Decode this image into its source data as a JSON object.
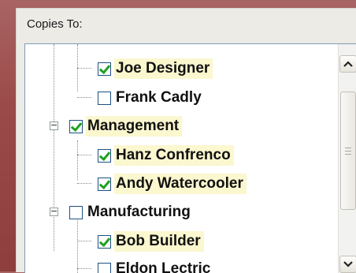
{
  "panel": {
    "label": "Copies To:"
  },
  "tree": {
    "rows": [
      {
        "label": "Joe Designer",
        "checked": true,
        "highlighted": true
      },
      {
        "label": "Frank Cadly",
        "checked": false,
        "highlighted": false
      },
      {
        "label": "Management",
        "checked": true,
        "highlighted": true,
        "group": true,
        "expander": "−"
      },
      {
        "label": "Hanz Confrenco",
        "checked": true,
        "highlighted": true
      },
      {
        "label": "Andy Watercooler",
        "checked": true,
        "highlighted": true
      },
      {
        "label": "Manufacturing",
        "checked": false,
        "highlighted": false,
        "group": true,
        "expander": "−"
      },
      {
        "label": "Bob Builder",
        "checked": true,
        "highlighted": true
      },
      {
        "label": "Eldon Lectric",
        "checked": false,
        "highlighted": false
      }
    ]
  },
  "colors": {
    "check": "#21a121",
    "highlight": "#fbf7cf",
    "border": "#1c5180"
  }
}
